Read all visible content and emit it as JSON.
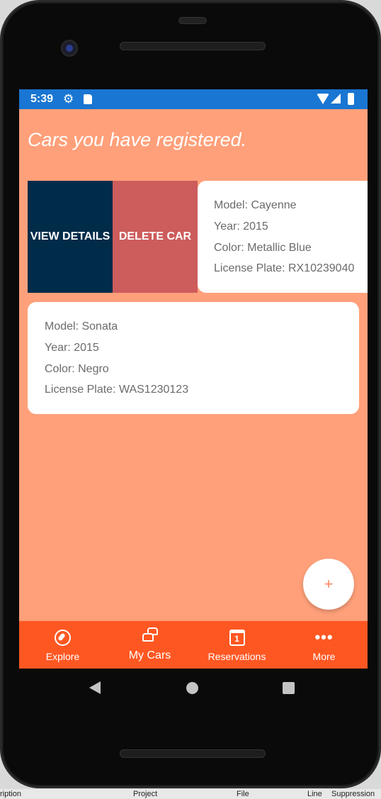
{
  "status_bar": {
    "time": "5:39",
    "icons": [
      "gear-icon",
      "sd-card-icon",
      "wifi-icon",
      "signal-icon",
      "battery-icon"
    ],
    "color": "#1976d2"
  },
  "page": {
    "title": "Cars you have registered.",
    "background": "#ffa07a"
  },
  "swipe_actions": {
    "view_details": "VIEW DETAILS",
    "delete_car": "DELETE CAR"
  },
  "cars": [
    {
      "model": "Model: Cayenne",
      "year": "Year: 2015",
      "color": "Color: Metallic Blue",
      "license_plate": "License Plate: RX10239040"
    },
    {
      "model": "Model: Sonata",
      "year": "Year: 2015",
      "color": "Color: Negro",
      "license_plate": "License Plate: WAS1230123"
    }
  ],
  "fab": {
    "label": "+",
    "icon": "plus-icon"
  },
  "bottom_nav": {
    "color": "#ff5722",
    "items": [
      {
        "label": "Explore",
        "icon": "compass-icon"
      },
      {
        "label": "My Cars",
        "icon": "cars-icon",
        "active": true
      },
      {
        "label": "Reservations",
        "icon": "calendar-icon",
        "calendar_day": "1"
      },
      {
        "label": "More",
        "icon": "more-dots-icon",
        "dots": "•••"
      }
    ]
  },
  "ide_strip": {
    "fragments": [
      "ription",
      "Project",
      "File",
      "Line",
      "Suppression S"
    ]
  }
}
